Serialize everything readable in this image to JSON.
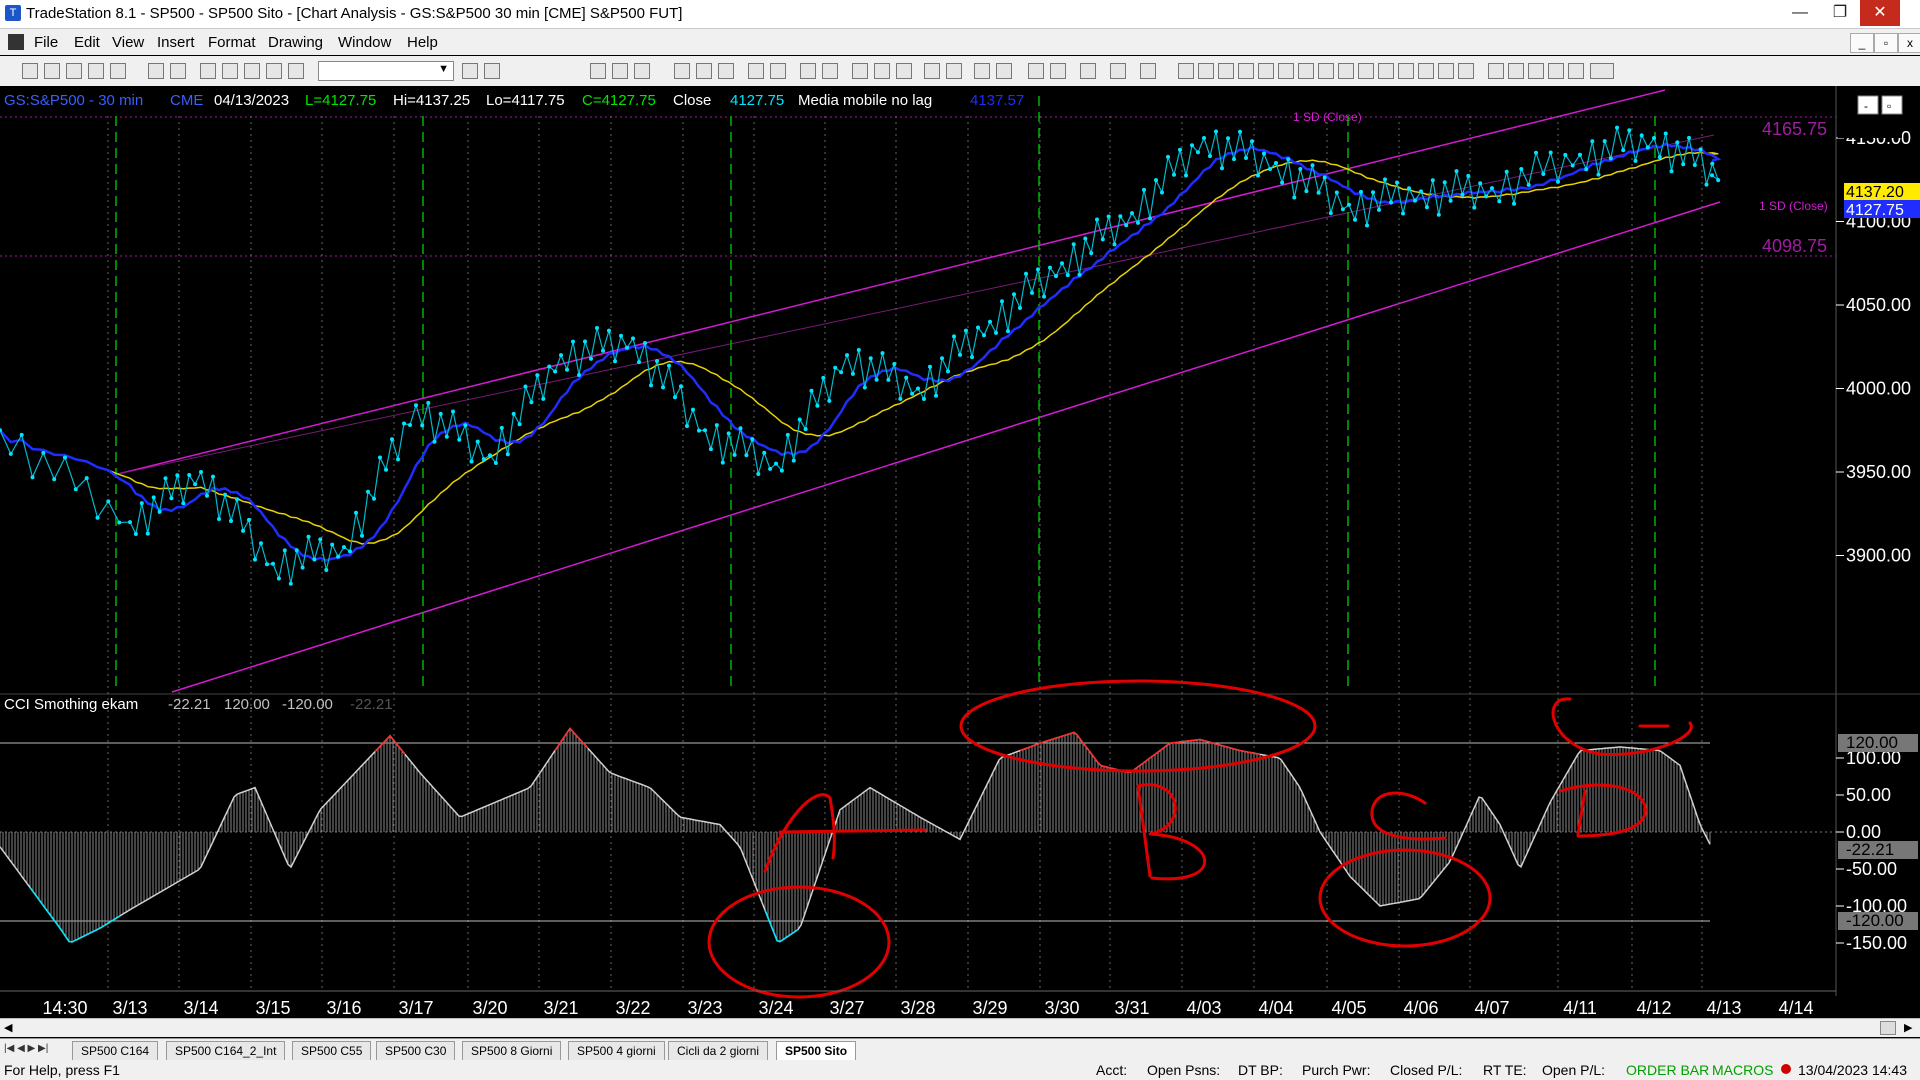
{
  "window": {
    "title": "TradeStation 8.1 - SP500 - SP500 Sito - [Chart Analysis - GS:S&P500  30 min  [CME] S&P500 FUT]",
    "app_icon": "tradestation-icon",
    "buttons": {
      "minimize": "—",
      "restore": "❐",
      "close": "✕"
    }
  },
  "menu": [
    "File",
    "Edit",
    "View",
    "Insert",
    "Format",
    "Drawing",
    "Window",
    "Help"
  ],
  "toolbar": {
    "combo_value": ""
  },
  "chart": {
    "header": {
      "symbol": "GS:S&P500 - 30 min",
      "exchange": "CME",
      "date": "04/13/2023",
      "last": "L=4127.75",
      "high": "Hi=4137.25",
      "low": "Lo=4117.75",
      "close": "C=4127.75",
      "close_label": "Close",
      "close_value": "4127.75",
      "ma_label": "Media mobile no lag",
      "ma_value": "4137.57"
    },
    "price_axis": [
      "4150.00",
      "4100.00",
      "4050.00",
      "4000.00",
      "3950.00",
      "3900.00"
    ],
    "price_tags": {
      "ma": "4137.20",
      "last": "4127.75",
      "upper_sd": "4165.75",
      "lower_sd": "4098.75"
    },
    "channel_labels": {
      "top": "1 SD (Close)",
      "right": "1 SD (Close)"
    },
    "dates": [
      "14:30",
      "3/13",
      "3/14",
      "3/15",
      "3/16",
      "3/17",
      "3/20",
      "3/21",
      "3/22",
      "3/23",
      "3/24",
      "3/27",
      "3/28",
      "3/29",
      "3/30",
      "3/31",
      "4/03",
      "4/04",
      "4/05",
      "4/06",
      "4/07",
      "4/11",
      "4/12",
      "4/13",
      "4/14"
    ],
    "indicator": {
      "name": "CCI Smothing ekam",
      "value": "-22.21",
      "upper": "120.00",
      "lower": "-120.00",
      "value2": "-22.21",
      "axis": [
        "120.00",
        "100.00",
        "50.00",
        "0.00",
        "-22.21",
        "-50.00",
        "-100.00",
        "-120.00",
        "-150.00"
      ]
    },
    "annotations": [
      "A",
      "B",
      "C",
      "D"
    ],
    "colors": {
      "price": "#00e5ff",
      "ma_fast": "#1f2dff",
      "ma_slow": "#e6d200",
      "channel": "#d41bd4",
      "cycle": "#00b300",
      "annotation": "#e00000",
      "cci": "#c8c8c8"
    }
  },
  "chart_data": {
    "type": "line",
    "title": "GS:S&P500 - 30 min",
    "x": [
      "3/13",
      "3/14",
      "3/15",
      "3/16",
      "3/17",
      "3/20",
      "3/21",
      "3/22",
      "3/23",
      "3/24",
      "3/27",
      "3/28",
      "3/29",
      "3/30",
      "3/31",
      "4/03",
      "4/04",
      "4/05",
      "4/06",
      "4/07",
      "4/11",
      "4/12",
      "4/13"
    ],
    "series": [
      {
        "name": "Close",
        "values": [
          3920,
          3950,
          3895,
          3905,
          3990,
          3960,
          4020,
          4030,
          3975,
          3955,
          4020,
          4000,
          4040,
          4075,
          4105,
          4150,
          4135,
          4110,
          4118,
          4120,
          4140,
          4150,
          4127.75
        ]
      }
    ],
    "ylim": [
      3870,
      4180
    ]
  },
  "tabs": [
    "SP500 C164",
    "SP500 C164_2_Int",
    "SP500 C55",
    "SP500 C30",
    "SP500 8 Giorni",
    "SP500 4 giorni",
    "Cicli da 2 giorni",
    "SP500 Sito"
  ],
  "active_tab": "SP500 Sito",
  "status": {
    "help": "For Help, press F1",
    "acct": "Acct:",
    "open_psns": "Open Psns:",
    "dt_bp": "DT BP:",
    "purch_pwr": "Purch Pwr:",
    "closed_pl": "Closed P/L:",
    "rt_te": "RT TE:",
    "open_pl": "Open P/L:",
    "order_bar": "ORDER BAR",
    "macros": "MACROS",
    "datetime": "13/04/2023 14:43"
  }
}
